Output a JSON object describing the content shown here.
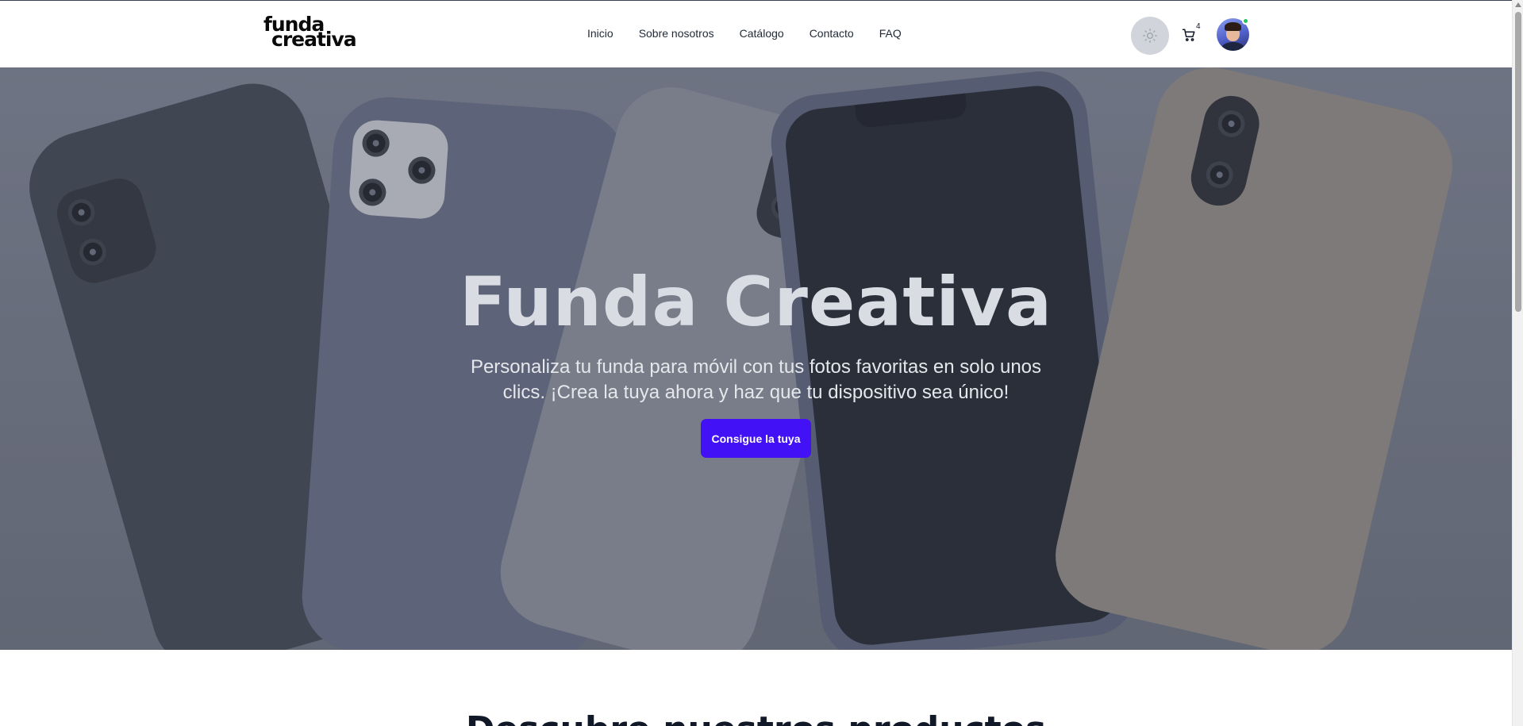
{
  "header": {
    "logo_line1": "funda",
    "logo_line2": "creativa",
    "nav": [
      "Inicio",
      "Sobre nosotros",
      "Catálogo",
      "Contacto",
      "FAQ"
    ],
    "cart_count": "4",
    "theme_icon": "sun-icon",
    "cart_icon": "cart-icon"
  },
  "hero": {
    "title": "Funda Creativa",
    "subtitle": "Personaliza tu funda para móvil con tus fotos favoritas en solo unos clics. ¡Crea la tuya ahora y haz que tu dispositivo sea único!",
    "cta_label": "Consigue la tuya"
  },
  "section": {
    "heading": "Descubre nuestros productos"
  },
  "colors": {
    "accent": "#4211f5",
    "status": "#22c55e"
  }
}
